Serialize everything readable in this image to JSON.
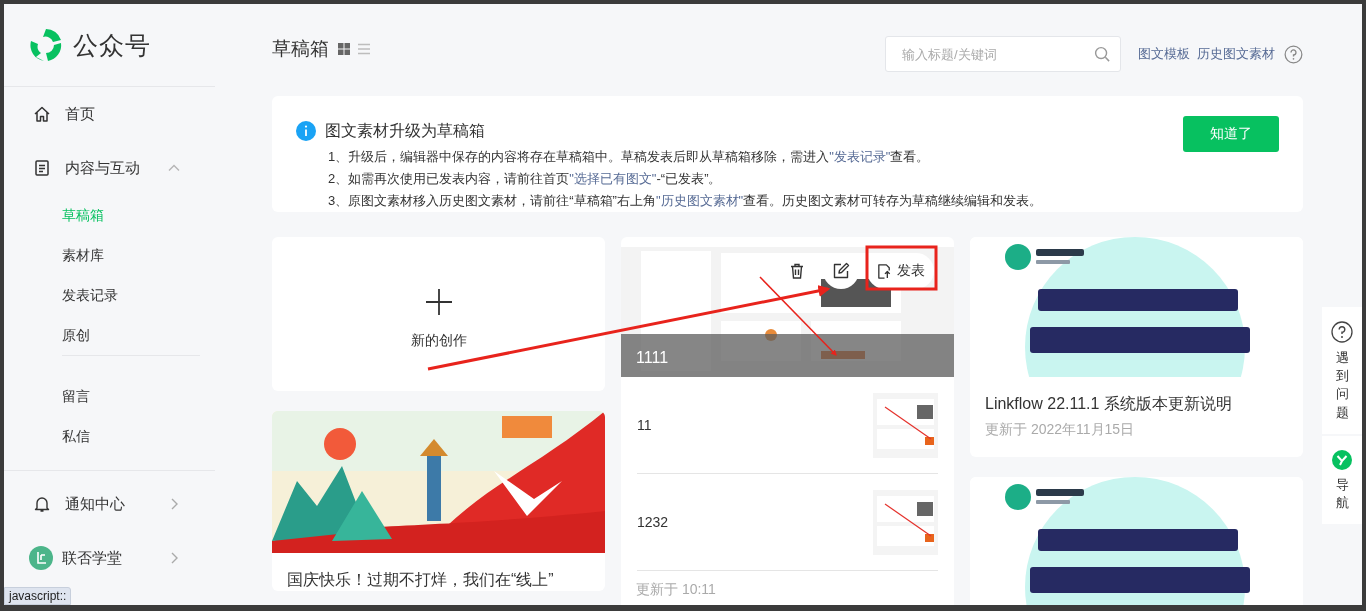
{
  "app": {
    "name": "公众号"
  },
  "sidebar": {
    "home": {
      "label": "首页"
    },
    "content": {
      "label": "内容与互动",
      "expanded": true,
      "sections": [
        {
          "items": [
            {
              "label": "草稿箱",
              "selected": true
            },
            {
              "label": "素材库",
              "selected": false
            },
            {
              "label": "发表记录",
              "selected": false
            },
            {
              "label": "原创",
              "selected": false
            }
          ]
        },
        {
          "items": [
            {
              "label": "留言",
              "selected": false
            },
            {
              "label": "私信",
              "selected": false
            }
          ]
        }
      ]
    },
    "footer": [
      {
        "label": "通知中心"
      },
      {
        "label": "联否学堂"
      }
    ]
  },
  "page": {
    "title": "草稿箱",
    "views": [
      {
        "kind": "grid",
        "selected": true
      },
      {
        "kind": "list",
        "selected": false
      }
    ]
  },
  "search": {
    "placeholder": "输入标题/关键词"
  },
  "header_links": [
    "图文模板",
    "历史图文素材"
  ],
  "notice": {
    "title": "图文素材升级为草稿箱",
    "button": "知道了",
    "lines": [
      [
        {
          "text": "1、升级后，编辑器中保存的内容将存在草稿箱中。草稿发表后即从草稿箱移除，需进入",
          "link": false
        },
        {
          "text": "\"发表记录\"",
          "link": true
        },
        {
          "text": "查看。",
          "link": false
        }
      ],
      [
        {
          "text": "2、如需再次使用已发表内容，请前往首页",
          "link": false
        },
        {
          "text": "\"选择已有图文\"",
          "link": true
        },
        {
          "text": "-“已发表”。",
          "link": false
        }
      ],
      [
        {
          "text": "3、原图文素材移入历史图文素材，请前往“草稿箱”右上角",
          "link": false
        },
        {
          "text": "\"历史图文素材\"",
          "link": true
        },
        {
          "text": "查看。历史图文素材可转存为草稿继续编辑和发表。",
          "link": false
        }
      ]
    ]
  },
  "new_card": {
    "label": "新的创作"
  },
  "columns": [
    [
      {
        "kind": "single",
        "title": "国庆快乐！过期不打烊，我们在“线上”"
      }
    ],
    [
      {
        "kind": "multi",
        "publish": "发表",
        "articles": [
          {
            "title": "1111"
          },
          {
            "title": "11"
          },
          {
            "title": "1232"
          }
        ],
        "updated": "更新于 10:11"
      }
    ],
    [
      {
        "kind": "single",
        "title": "Linkflow 22.11.1 系统版本更新说明",
        "updated": "更新于 2022年11月15日"
      },
      {
        "kind": "picture"
      }
    ]
  ],
  "help_panel": [
    {
      "label": "遇到问题"
    },
    {
      "label": "导航"
    }
  ],
  "status_bar": "javascript::"
}
